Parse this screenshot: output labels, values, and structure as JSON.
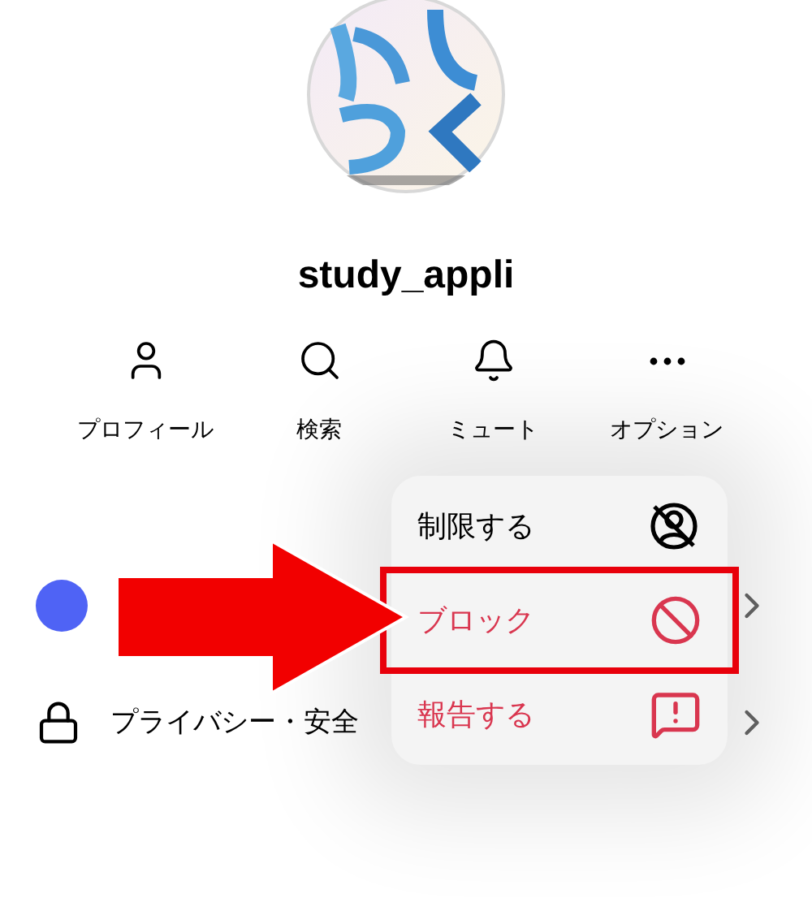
{
  "profile": {
    "username": "study_appli"
  },
  "actions": [
    {
      "kind": "person",
      "label": "プロフィール"
    },
    {
      "kind": "search",
      "label": "検索"
    },
    {
      "kind": "bell",
      "label": "ミュート"
    },
    {
      "kind": "more",
      "label": "オプション"
    }
  ],
  "rows": [
    {
      "kind": "dot",
      "color": "#4f63f5"
    },
    {
      "kind": "lock",
      "label": "プライバシー・安全"
    }
  ],
  "menu": {
    "items": [
      {
        "kind": "restrict",
        "label": "制限する",
        "danger": false,
        "highlighted": false
      },
      {
        "kind": "block",
        "label": "ブロック",
        "danger": true,
        "highlighted": true
      },
      {
        "kind": "report",
        "label": "報告する",
        "danger": true,
        "highlighted": false
      }
    ]
  },
  "annotation": {
    "kind": "arrow"
  }
}
